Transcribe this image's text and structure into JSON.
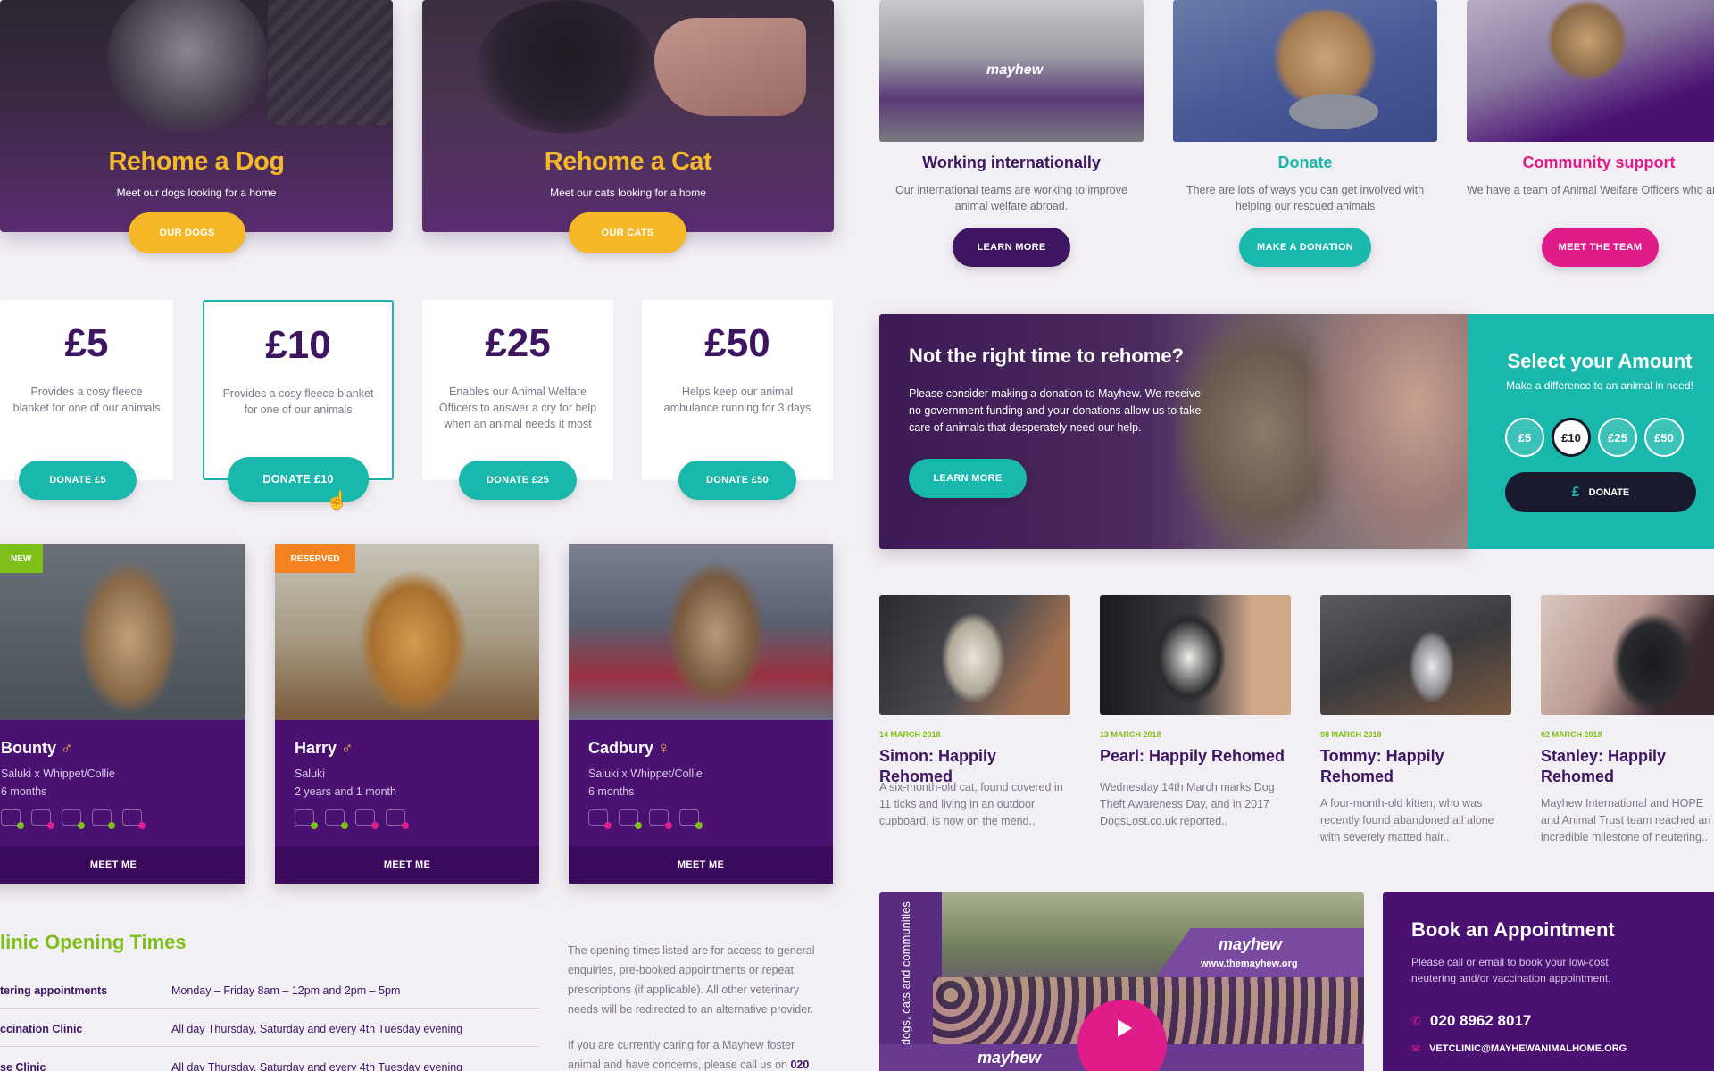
{
  "rehome_dog": {
    "title": "Rehome a Dog",
    "subtitle": "Meet our dogs looking for a home",
    "button": "OUR DOGS"
  },
  "rehome_cat": {
    "title": "Rehome a Cat",
    "subtitle": "Meet our cats looking for a home",
    "button": "OUR CATS"
  },
  "features": [
    {
      "title": "Working internationally",
      "desc": "Our international teams are working to improve animal welfare abroad.",
      "button": "LEARN MORE",
      "color": "#3d1560"
    },
    {
      "title": "Donate",
      "desc": "There are lots of ways you can get involved with helping our rescued animals",
      "button": "MAKE A DONATION",
      "color": "#1ab8ac"
    },
    {
      "title": "Community support",
      "desc": "We have a team of Animal Welfare Officers who are rescuing animals every day.",
      "button": "MEET THE TEAM",
      "color": "#e01c8a"
    }
  ],
  "amounts": [
    {
      "value": "£5",
      "desc": "Provides a cosy fleece blanket for one of our animals",
      "button": "DONATE £5"
    },
    {
      "value": "£10",
      "desc": "Provides a cosy fleece blanket for one of our animals",
      "button": "DONATE £10"
    },
    {
      "value": "£25",
      "desc": "Enables our Animal Welfare Officers to answer a cry for help when an animal needs it most",
      "button": "DONATE £25"
    },
    {
      "value": "£50",
      "desc": "Helps keep our animal ambulance running for 3 days",
      "button": "DONATE £50"
    }
  ],
  "not_right_time": {
    "title": "Not the right time to rehome?",
    "body": "Please consider making a donation to Mayhew. We receive no government funding and your donations allow us to take care of animals that desperately need our help.",
    "button": "LEARN MORE"
  },
  "select_amount": {
    "title": "Select your Amount",
    "subtitle": "Make a difference to an animal in need!",
    "options": [
      "£5",
      "£10",
      "£25",
      "£50"
    ],
    "selected": "£10",
    "button": "DONATE",
    "currency_symbol": "£"
  },
  "pets": [
    {
      "badge": "NEW",
      "badge_color": "#7fbf1a",
      "name": "Bounty",
      "sex_symbol": "♂",
      "breed": "Saluki x Whippet/Collie",
      "age": "6 months",
      "button": "MEET ME"
    },
    {
      "badge": "RESERVED",
      "badge_color": "#f58220",
      "name": "Harry",
      "sex_symbol": "♂",
      "breed": "Saluki",
      "age": "2 years and 1 month",
      "button": "MEET ME"
    },
    {
      "badge": "",
      "badge_color": "",
      "name": "Cadbury",
      "sex_symbol": "♀",
      "breed": "Saluki x Whippet/Collie",
      "age": "6 months",
      "button": "MEET ME"
    }
  ],
  "news": [
    {
      "date": "14 MARCH 2018",
      "title": "Simon: Happily Rehomed",
      "desc": "A six-month-old cat, found covered in 11 ticks and living in an outdoor cupboard, is now on the mend.."
    },
    {
      "date": "13 MARCH 2018",
      "title": "Pearl: Happily Rehomed",
      "desc": "Wednesday 14th March marks Dog Theft Awareness Day, and in 2017 DogsLost.co.uk reported.."
    },
    {
      "date": "08 MARCH 2018",
      "title": "Tommy: Happily Rehomed",
      "desc": "A four-month-old kitten, who was recently found abandoned all alone with severely matted hair.."
    },
    {
      "date": "02 MARCH 2018",
      "title": "Stanley: Happily Rehomed",
      "desc": "Mayhew International and HOPE and Animal Trust team reached an incredible milestone of neutering.."
    }
  ],
  "clinic": {
    "title": "linic Opening Times",
    "rows": [
      {
        "label": "tering appointments",
        "value": "Monday – Friday 8am – 12pm and 2pm – 5pm"
      },
      {
        "label": "ccination Clinic",
        "value": "All day Thursday, Saturday and every 4th Tuesday evening"
      },
      {
        "label": "se Clinic",
        "value": "All day Thursday, Saturday and every 4th Tuesday evening"
      }
    ],
    "note1": "The opening times listed are for access to general enquiries, pre-booked appointments or repeat prescriptions (if applicable). All other veterinary needs will be redirected to an alternative provider.",
    "note2_prefix": "If you are currently caring for a Mayhew foster animal and have concerns, please call us on",
    "note2_bold": "020"
  },
  "appointment": {
    "title": "Book an Appointment",
    "desc": "Please call or email to book your low-cost neutering and/or vaccination appointment.",
    "phone": "020 8962 8017",
    "email": "VETCLINIC@MAYHEWANIMALHOME.ORG"
  },
  "video": {
    "banner_text": "mayhew",
    "site_text": "www.themayhew.org",
    "flag_text": "for dogs, cats and communities"
  },
  "colors": {
    "purple": "#3d1560",
    "teal": "#1ab8ac",
    "magenta": "#e01c8a",
    "yellow": "#f4b829",
    "green": "#7fbf1a"
  }
}
